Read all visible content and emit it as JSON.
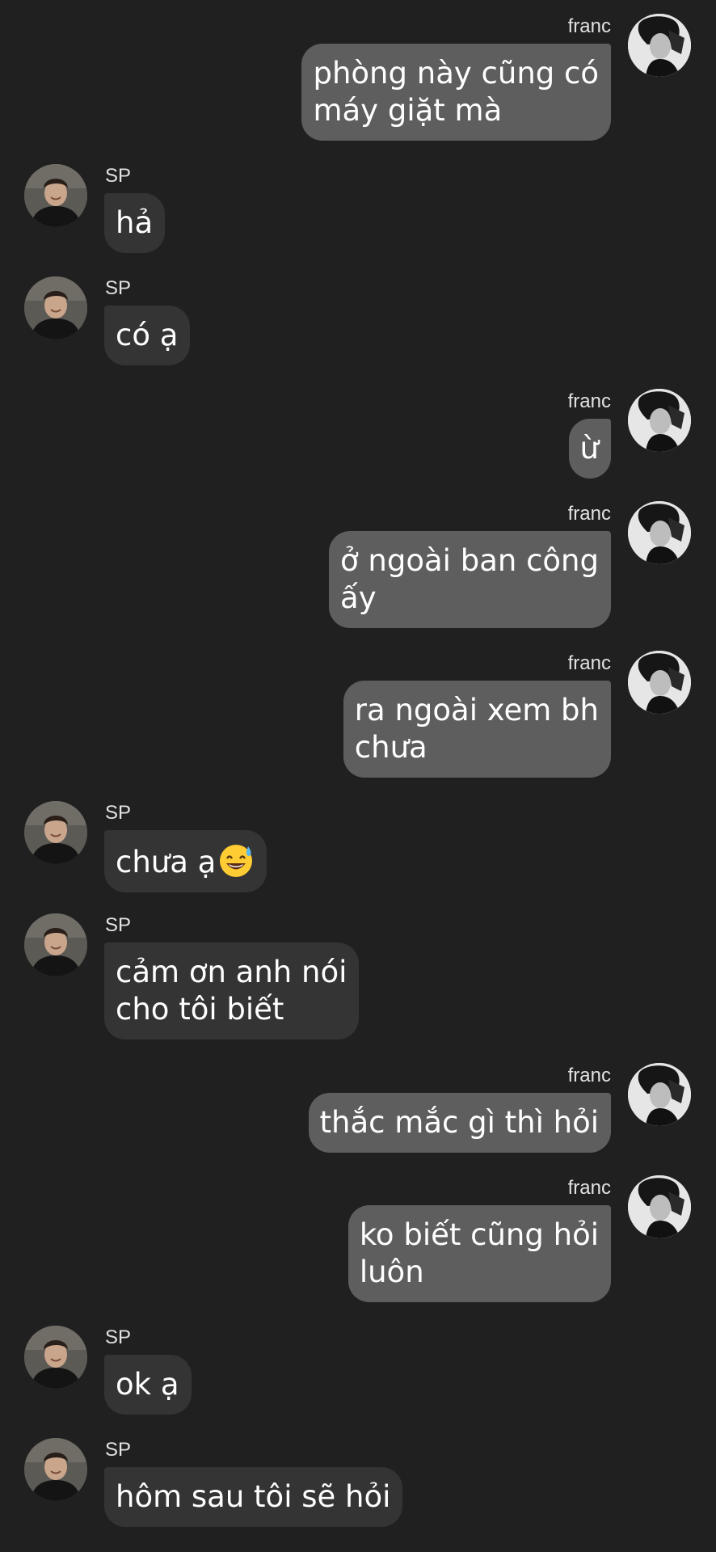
{
  "messages": [
    {
      "side": "out",
      "sender": "franc",
      "lines": [
        "phòng này cũng có",
        "máy giặt mà"
      ]
    },
    {
      "side": "in",
      "sender": "SP",
      "lines": [
        "hả"
      ]
    },
    {
      "side": "in",
      "sender": "SP",
      "lines": [
        "có ạ"
      ]
    },
    {
      "side": "out",
      "sender": "franc",
      "lines": [
        "ừ"
      ]
    },
    {
      "side": "out",
      "sender": "franc",
      "lines": [
        "ở ngoài ban công",
        "ấy"
      ]
    },
    {
      "side": "out",
      "sender": "franc",
      "lines": [
        "ra ngoài xem bh",
        "chưa"
      ]
    },
    {
      "side": "in",
      "sender": "SP",
      "lines": [
        "chưa ạ"
      ],
      "emoji": "grinning-sweat-emoji"
    },
    {
      "side": "in",
      "sender": "SP",
      "lines": [
        "cảm ơn anh nói",
        "cho tôi biết"
      ]
    },
    {
      "side": "out",
      "sender": "franc",
      "lines": [
        "thắc mắc gì thì hỏi"
      ]
    },
    {
      "side": "out",
      "sender": "franc",
      "lines": [
        "ko biết cũng hỏi",
        "luôn"
      ]
    },
    {
      "side": "in",
      "sender": "SP",
      "lines": [
        "ok ạ"
      ]
    },
    {
      "side": "in",
      "sender": "SP",
      "lines": [
        "hôm sau tôi sẽ hỏi"
      ]
    }
  ],
  "theme": {
    "background": "#202020",
    "incoming_bubble": "#343434",
    "outgoing_bubble": "#5e5e5e",
    "text": "#ffffff",
    "name_text": "#e2e2e2"
  },
  "icons": {
    "incoming_avatar": "avatar-photo-icon",
    "outgoing_avatar": "avatar-photo-icon"
  }
}
